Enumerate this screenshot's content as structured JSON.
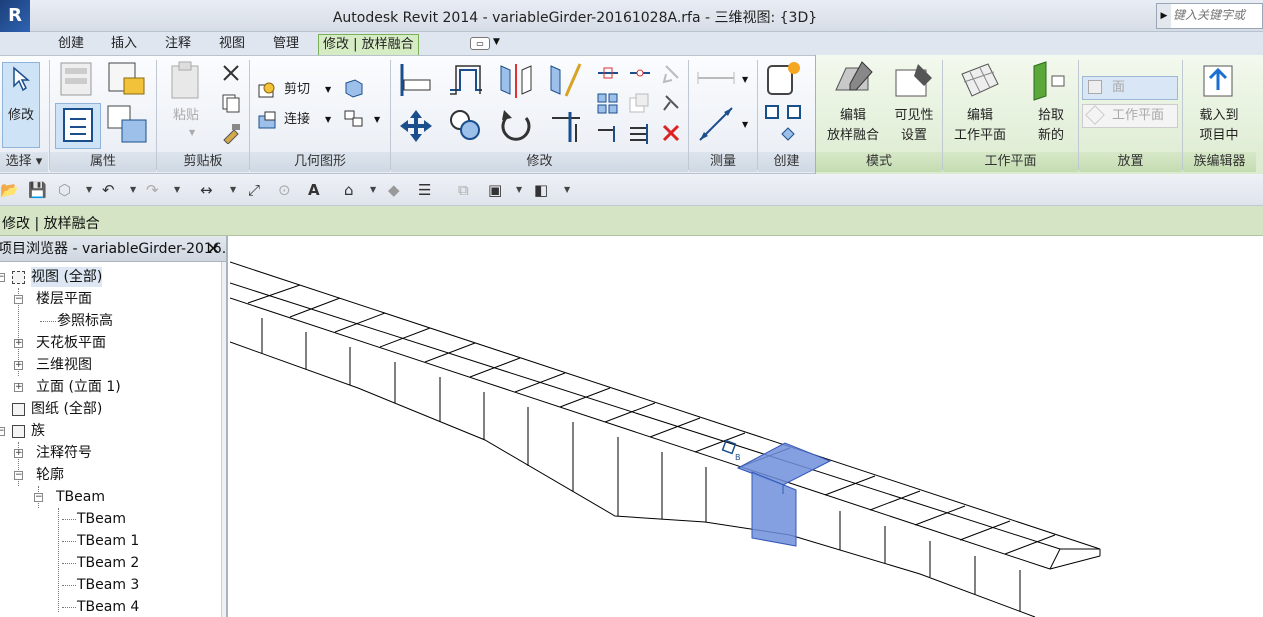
{
  "app": {
    "title": "Autodesk Revit 2014 -     variableGirder-20161028A.rfa - 三维视图: {3D}",
    "search_placeholder": "键入关键字或"
  },
  "tabs": [
    "创建",
    "插入",
    "注释",
    "视图",
    "管理",
    "修改 | 放样融合"
  ],
  "ribbon": {
    "select": {
      "button": "修改",
      "panel": "选择"
    },
    "properties": {
      "panel": "属性"
    },
    "clipboard": {
      "paste": "粘贴",
      "panel": "剪贴板"
    },
    "geometry": {
      "cut": "剪切",
      "join": "连接",
      "panel": "几何图形"
    },
    "modify": {
      "panel": "修改"
    },
    "measure": {
      "panel": "测量"
    },
    "create": {
      "panel": "创建"
    },
    "mode": {
      "edit_line1": "编辑",
      "edit_line2": "放样融合",
      "vis_line1": "可见性",
      "vis_line2": "设置",
      "panel": "模式"
    },
    "workplane": {
      "edit_line1": "编辑",
      "edit_line2": "工作平面",
      "pick_line1": "拾取",
      "pick_line2": "新的",
      "panel": "工作平面"
    },
    "place": {
      "face": "面",
      "workplane": "工作平面",
      "panel": "放置"
    },
    "family_editor": {
      "load_line1": "载入到",
      "load_line2": "项目中",
      "panel": "族编辑器"
    }
  },
  "context_bar": "修改 | 放样融合",
  "browser": {
    "title": "项目浏览器 - variableGirder-2016...",
    "items": [
      "视图 (全部)",
      "楼层平面",
      "参照标高",
      "天花板平面",
      "三维视图",
      "立面 (立面 1)",
      "图纸 (全部)",
      "族",
      "注释符号",
      "轮廓",
      "TBeam",
      "TBeam",
      "TBeam 1",
      "TBeam 2",
      "TBeam 3",
      "TBeam 4"
    ]
  },
  "viewport": {
    "selected_element": "blend segment",
    "highlight_color": "#6f8fdc"
  },
  "colors": {
    "ribbon_context": "#d6ecc5",
    "context_bar": "#d4e4c4",
    "selection": "#6f8fdc"
  }
}
